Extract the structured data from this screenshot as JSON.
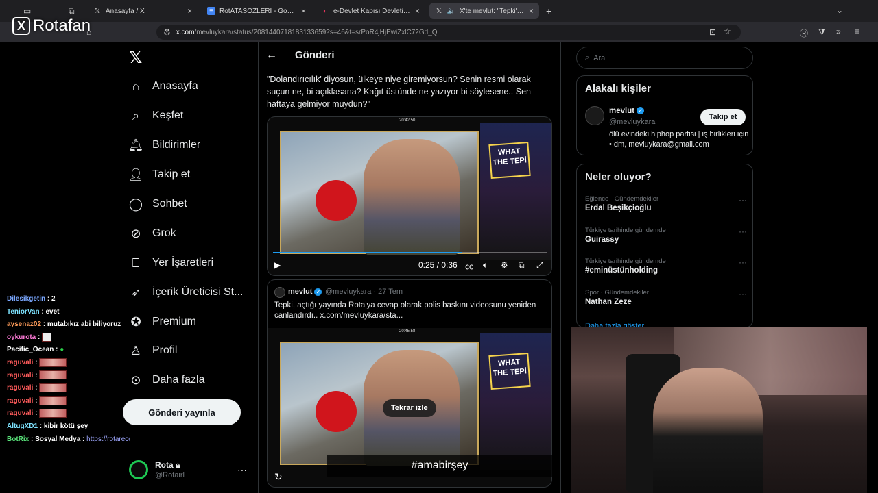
{
  "browser": {
    "tabs": [
      {
        "title": "Anasayfa / X",
        "favicon": "x-logo-icon"
      },
      {
        "title": "RotATASÖZLERİ - Google Doküm",
        "favicon": "docs-icon"
      },
      {
        "title": "e-Devlet Kapısı Devletin Kısayol",
        "favicon": "edevlet-icon"
      },
      {
        "title": "X'te mevlut: \"Tepki'den Rota",
        "favicon": "x-logo-icon"
      }
    ],
    "url_host": "x.com",
    "url_path": "/mevluykara/status/2081440718183133659?s=46&t=srPoR4jHjEwiZxlC72Gd_Q"
  },
  "overlay": {
    "brand": "Rotafan",
    "hashtag": "#amabirşey"
  },
  "nav": {
    "items": [
      {
        "label": "Anasayfa",
        "icon": "home-icon"
      },
      {
        "label": "Keşfet",
        "icon": "search-icon"
      },
      {
        "label": "Bildirimler",
        "icon": "bell-icon"
      },
      {
        "label": "Takip et",
        "icon": "add-person-icon"
      },
      {
        "label": "Sohbet",
        "icon": "chat-icon"
      },
      {
        "label": "Grok",
        "icon": "grok-icon"
      },
      {
        "label": "Yer İşaretleri",
        "icon": "bookmark-icon"
      },
      {
        "label": "İçerik Üreticisi St...",
        "icon": "rocket-icon"
      },
      {
        "label": "Premium",
        "icon": "premium-icon"
      },
      {
        "label": "Profil",
        "icon": "person-icon"
      },
      {
        "label": "Daha fazla",
        "icon": "more-icon"
      }
    ],
    "post_button": "Gönderi yayınla",
    "profile_name": "Rota",
    "profile_handle": "@Rotairl"
  },
  "chat": [
    {
      "user": "Dilesikgetin",
      "msg": ": 2",
      "color": "#7aa7ff"
    },
    {
      "user": "TeniorVan",
      "msg": ": evet",
      "color": "#7de3ff"
    },
    {
      "user": "aysenaz02",
      "msg": ": mutabıkız abi biliyoruz",
      "color": "#ff9c5a"
    },
    {
      "user": "oykurota",
      "msg": ":",
      "color": "#ff7bd8"
    },
    {
      "user": "Pacific_Ocean",
      "msg": ":",
      "color": "#ffffff"
    },
    {
      "user": "raguvali",
      "msg": ":",
      "color": "#ff5b5b"
    },
    {
      "user": "raguvali",
      "msg": ":",
      "color": "#ff5b5b"
    },
    {
      "user": "raguvali",
      "msg": ":",
      "color": "#ff5b5b"
    },
    {
      "user": "raguvali",
      "msg": ":",
      "color": "#ff5b5b"
    },
    {
      "user": "raguvali",
      "msg": ":",
      "color": "#ff5b5b"
    },
    {
      "user": "AltugXD1",
      "msg": ": kibir kötü şey",
      "color": "#7de3ff"
    },
    {
      "user": "BotRix",
      "msg": ": Sosyal Medya : ",
      "link": "https://rotarecords.com",
      "color": "#59e37a"
    }
  ],
  "post": {
    "header": "Gönderi",
    "text": "\"Dolandırıcılık' diyosun, ülkeye niye giremiyorsun? Senin resmi olarak suçun ne, bi açıklasana? Kağıt üstünde ne yazıyor bi söylesene.. Sen haftaya gelmiyor muydun?\"",
    "video_time": "0:25 / 0:36",
    "stream_clock_1": "20:42:50",
    "overlay_title": "WHAT THE TEPİ"
  },
  "quote": {
    "name": "mevlut",
    "handle_time": "@mevluykara · 27 Tem",
    "text": "Tepki, açtığı yayında Rota'ya cevap olarak polis baskını videosunu yeniden canlandırdı..  x.com/mevluykara/sta...",
    "replay_label": "Tekrar izle",
    "stream_clock_2": "20:45:58"
  },
  "right": {
    "search_placeholder": "Ara",
    "relevant_title": "Alakalı kişiler",
    "person_name": "mevlut",
    "person_handle": "@mevluykara",
    "person_bio": "ölü evindeki hiphop partisi | iş birlikleri için • dm, mevluykara@gmail.com",
    "follow_label": "Takip et",
    "trends_title": "Neler oluyor?",
    "trends": [
      {
        "meta": "Eğlence · Gündemdekiler",
        "name": "Erdal Beşikçioğlu"
      },
      {
        "meta": "Türkiye tarihinde gündemde",
        "name": "Guirassy"
      },
      {
        "meta": "Türkiye tarihinde gündemde",
        "name": "#eminüstünholding"
      },
      {
        "meta": "Spor · Gündemdekiler",
        "name": "Nathan Zeze"
      }
    ],
    "show_more": "Daha fazla göster"
  }
}
